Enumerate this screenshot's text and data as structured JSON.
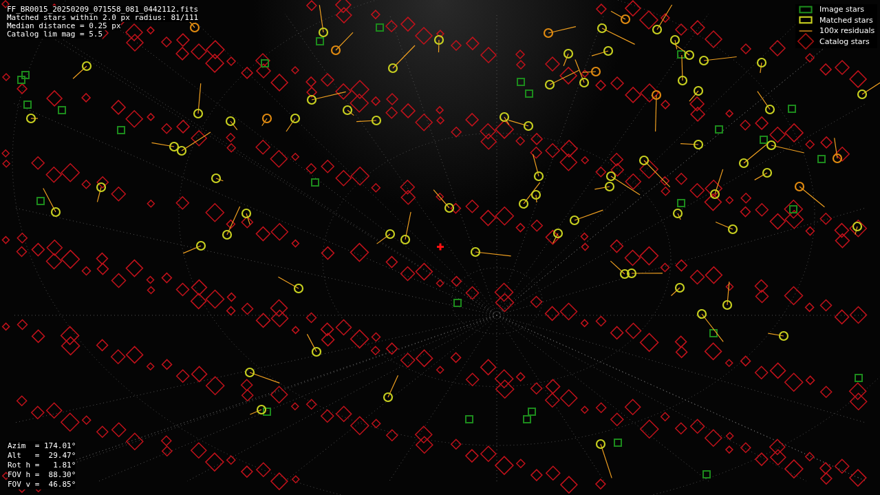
{
  "header": [
    "FF_BR0015_20250209_071558_081_0442112.fits",
    "Matched stars within 2.0 px radius: 81/111",
    "Median distance = 0.25 px",
    "Catalog lim mag = 5.5"
  ],
  "legend": [
    {
      "kind": "image",
      "label": "Image stars"
    },
    {
      "kind": "matched",
      "label": "Matched stars"
    },
    {
      "kind": "residual",
      "label": "100x residuals"
    },
    {
      "kind": "catalog",
      "label": "Catalog stars"
    }
  ],
  "pointing": [
    "Azim  = 174.01°",
    "Alt   =  29.47°",
    "Rot h =   1.81°",
    "FOV h =  88.30°",
    "FOV v =  46.85°"
  ]
}
